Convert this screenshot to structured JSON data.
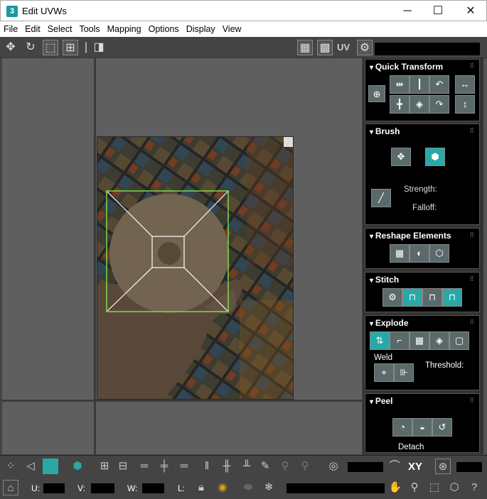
{
  "window": {
    "title": "Edit UVWs",
    "app_icon": "3",
    "minimize": "─",
    "maximize": "☐",
    "close": "✕"
  },
  "menu": [
    "File",
    "Edit",
    "Select",
    "Tools",
    "Mapping",
    "Options",
    "Display",
    "View"
  ],
  "toolbar": {
    "uv_label": "UV"
  },
  "panel": {
    "quick_transform": "Quick Transform",
    "brush": "Brush",
    "strength": "Strength:",
    "falloff": "Falloff:",
    "reshape": "Reshape Elements",
    "stitch": "Stitch",
    "explode": "Explode",
    "weld": "Weld",
    "threshold": "Threshold:",
    "peel": "Peel",
    "detach": "Detach"
  },
  "bottom": {
    "xy": "XY",
    "u_label": "U:",
    "v_label": "V:",
    "w_label": "W:",
    "l_label": "L:"
  },
  "colors": {
    "selection_green": "#7cdc4a",
    "accent_teal": "#2aa8a8"
  }
}
